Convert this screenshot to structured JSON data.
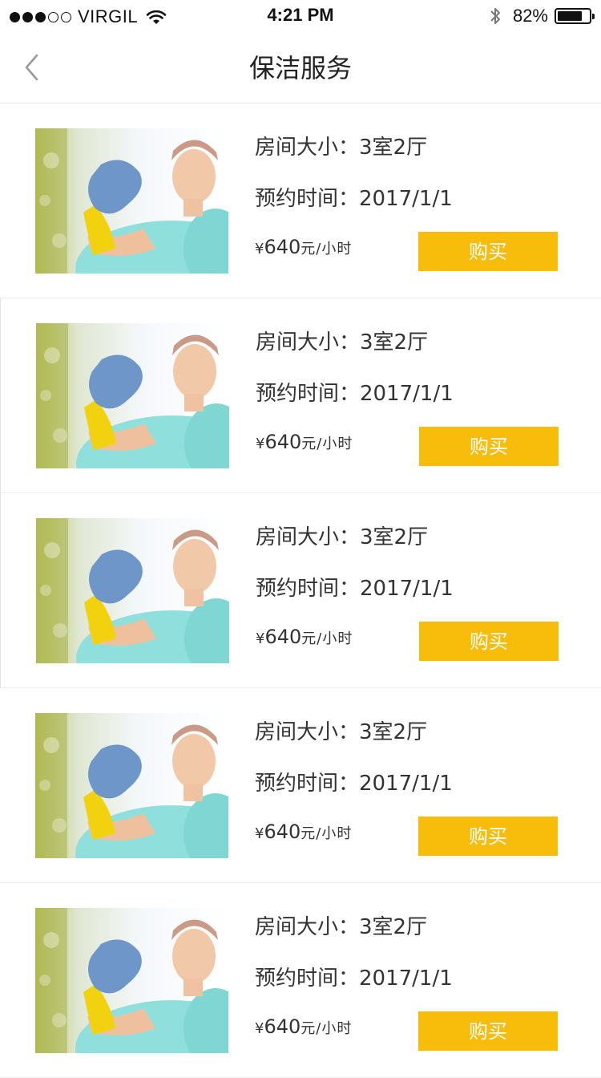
{
  "status_bar": {
    "carrier": "VIRGIL",
    "signal_bars_filled": 3,
    "signal_bars_total": 5,
    "time": "4:21 PM",
    "battery_percent": "82%",
    "battery_level": 0.82
  },
  "nav": {
    "back_icon": "chevron-left-icon",
    "title": "保洁服务"
  },
  "colors": {
    "accent": "#f8bc0a",
    "text": "#333333",
    "divider": "#ececec"
  },
  "items": [
    {
      "room_size": "房间大小：3室2厅",
      "appointment": "预约时间：2017/1/1",
      "price_currency": "¥",
      "price_amount": "640",
      "price_unit": "元/小时",
      "buy_label": "购买"
    },
    {
      "room_size": "房间大小：3室2厅",
      "appointment": "预约时间：2017/1/1",
      "price_currency": "¥",
      "price_amount": "640",
      "price_unit": "元/小时",
      "buy_label": "购买"
    },
    {
      "room_size": "房间大小：3室2厅",
      "appointment": "预约时间：2017/1/1",
      "price_currency": "¥",
      "price_amount": "640",
      "price_unit": "元/小时",
      "buy_label": "购买"
    },
    {
      "room_size": "房间大小：3室2厅",
      "appointment": "预约时间：2017/1/1",
      "price_currency": "¥",
      "price_amount": "640",
      "price_unit": "元/小时",
      "buy_label": "购买"
    },
    {
      "room_size": "房间大小：3室2厅",
      "appointment": "预约时间：2017/1/1",
      "price_currency": "¥",
      "price_amount": "640",
      "price_unit": "元/小时",
      "buy_label": "购买"
    }
  ]
}
